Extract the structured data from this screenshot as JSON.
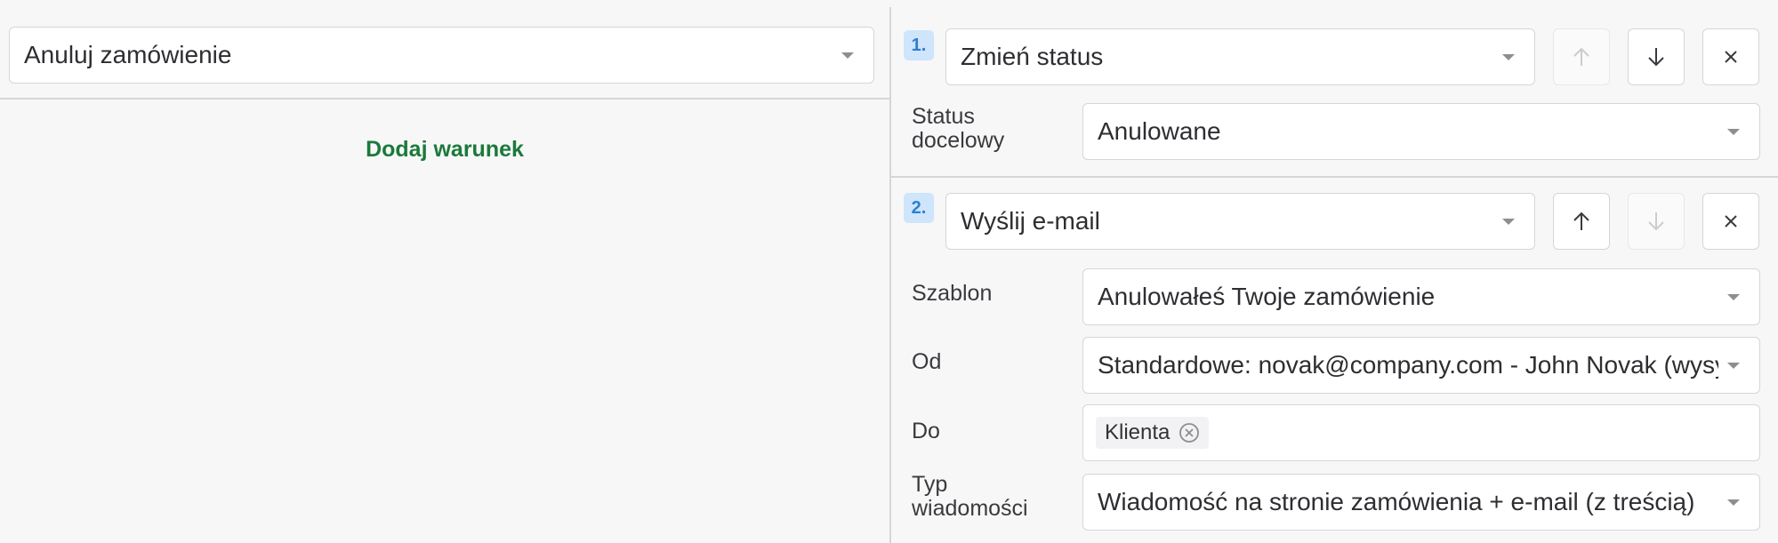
{
  "left": {
    "trigger_value": "Anuluj zamówienie",
    "add_condition_label": "Dodaj warunek"
  },
  "actions": [
    {
      "number": "1.",
      "type_value": "Zmień status",
      "fields": [
        {
          "label": "Status docelowy",
          "value": "Anulowane"
        }
      ]
    },
    {
      "number": "2.",
      "type_value": "Wyślij e-mail",
      "fields": [
        {
          "label": "Szablon",
          "value": "Anulowałeś Twoje zamówienie"
        },
        {
          "label": "Od",
          "value": "Standardowe: novak@company.com - John Novak (wysyłanie"
        },
        {
          "label": "Do",
          "tag": "Klienta"
        },
        {
          "label": "Typ wiadomości",
          "value": "Wiadomość na stronie zamówienia + e-mail (z treścią)"
        }
      ]
    }
  ],
  "colors": {
    "accent_green": "#1a7a3a",
    "badge_bg": "#cfe5fb",
    "badge_text": "#2f7fd0"
  },
  "icons": [
    "arrow-up-icon",
    "arrow-down-icon",
    "close-icon",
    "chevron-down-icon",
    "clear-circle-icon"
  ]
}
